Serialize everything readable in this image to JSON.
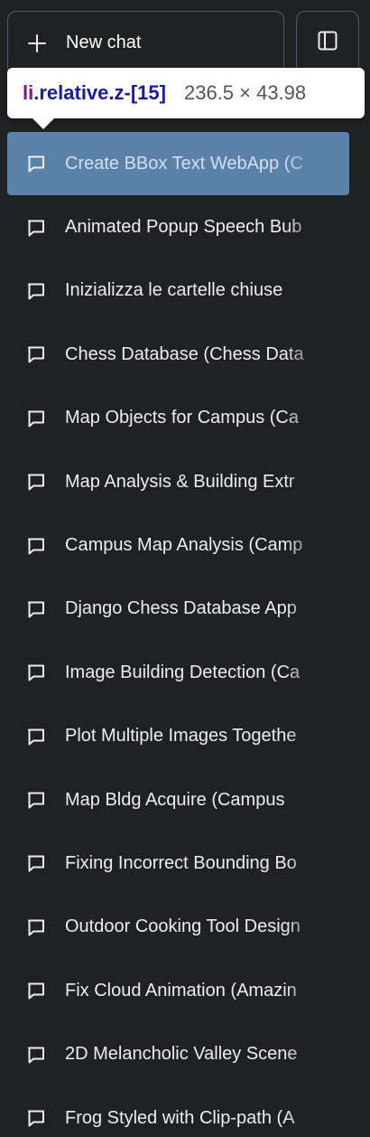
{
  "sidebar": {
    "new_chat_label": "New chat",
    "new_chat_icon": "plus-icon",
    "toggle_icon": "sidebar-toggle-icon"
  },
  "inspector_tooltip": {
    "tag": "li",
    "selector": ".relative.z-[15]",
    "dimensions": "236.5 × 43.98"
  },
  "history": {
    "item_icon": "chat-bubble-icon",
    "selected_index": 0,
    "items": [
      "Create BBox Text WebApp (C",
      "Animated Popup Speech Bub",
      "Inizializza le cartelle chiuse",
      "Chess Database (Chess Data",
      "Map Objects for Campus (Ca",
      "Map Analysis & Building Extr",
      "Campus Map Analysis (Camp",
      "Django Chess Database App",
      "Image Building Detection (Ca",
      "Plot Multiple Images Togethe",
      "Map Bldg Acquire (Campus",
      "Fixing Incorrect Bounding Bo",
      "Outdoor Cooking Tool Design",
      "Fix Cloud Animation (Amazin",
      "2D Melancholic Valley Scene",
      "Frog Styled with Clip-path (A"
    ]
  },
  "colors": {
    "background": "#202123",
    "selected_highlight": "#5b81a8",
    "border": "#565869",
    "text": "#ececf1"
  }
}
